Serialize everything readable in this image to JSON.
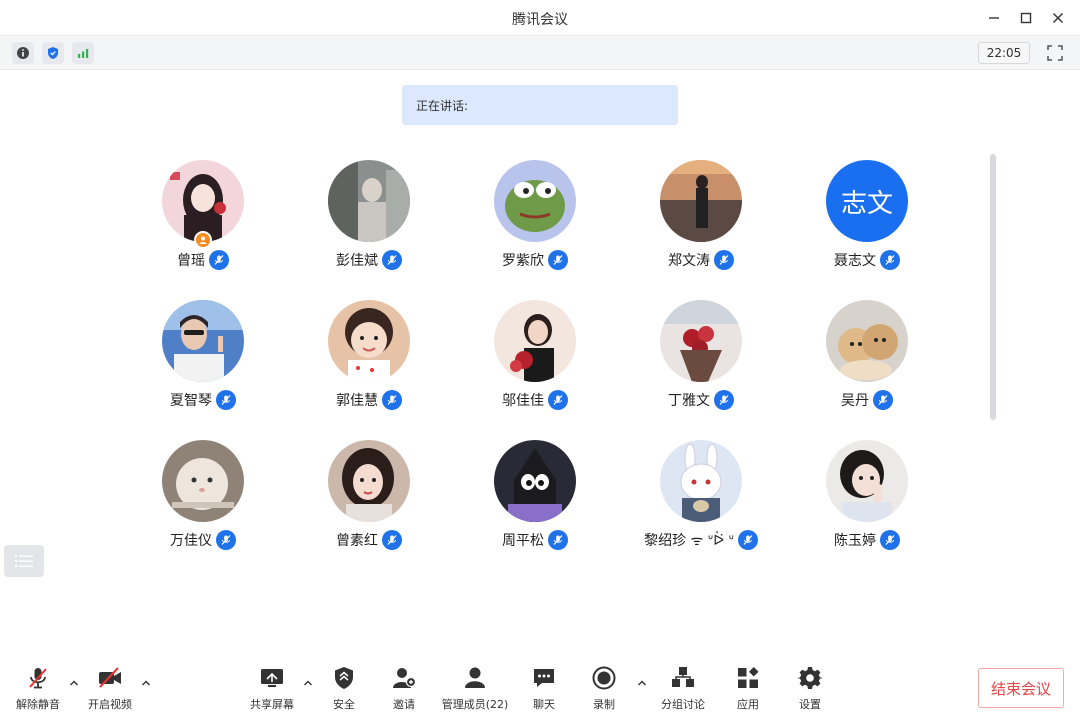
{
  "window": {
    "title": "腾讯会议"
  },
  "infobar": {
    "time": "22:05"
  },
  "speaking": {
    "label": "正在讲话:"
  },
  "participants": [
    {
      "name": "曾瑶",
      "avatar": "anime-girl",
      "host": true
    },
    {
      "name": "彭佳斌",
      "avatar": "photo-gray"
    },
    {
      "name": "罗紫欣",
      "avatar": "frog"
    },
    {
      "name": "郑文涛",
      "avatar": "photo-sunset"
    },
    {
      "name": "聂志文",
      "avatar": "text",
      "avatar_text": "志文"
    },
    {
      "name": "夏智琴",
      "avatar": "photo-blue"
    },
    {
      "name": "郭佳慧",
      "avatar": "child"
    },
    {
      "name": "邬佳佳",
      "avatar": "girl-red"
    },
    {
      "name": "丁雅文",
      "avatar": "flowers"
    },
    {
      "name": "吴丹",
      "avatar": "cats"
    },
    {
      "name": "万佳仪",
      "avatar": "cat-white"
    },
    {
      "name": "曾素红",
      "avatar": "girl-dark"
    },
    {
      "name": "周平松",
      "avatar": "cartoon-purple"
    },
    {
      "name": "黎绍珍 ᯤ ᐡᐖ ᐡ",
      "avatar": "bunny"
    },
    {
      "name": "陈玉婷",
      "avatar": "girl-light"
    }
  ],
  "toolbar": {
    "unmute": "解除静音",
    "video": "开启视频",
    "share": "共享屏幕",
    "security": "安全",
    "invite": "邀请",
    "members": "管理成员(22)",
    "chat": "聊天",
    "record": "录制",
    "breakout": "分组讨论",
    "apps": "应用",
    "settings": "设置",
    "end": "结束会议"
  },
  "colors": {
    "accent": "#1f72ea",
    "end": "#e64545",
    "banner": "#dbe8fd"
  }
}
